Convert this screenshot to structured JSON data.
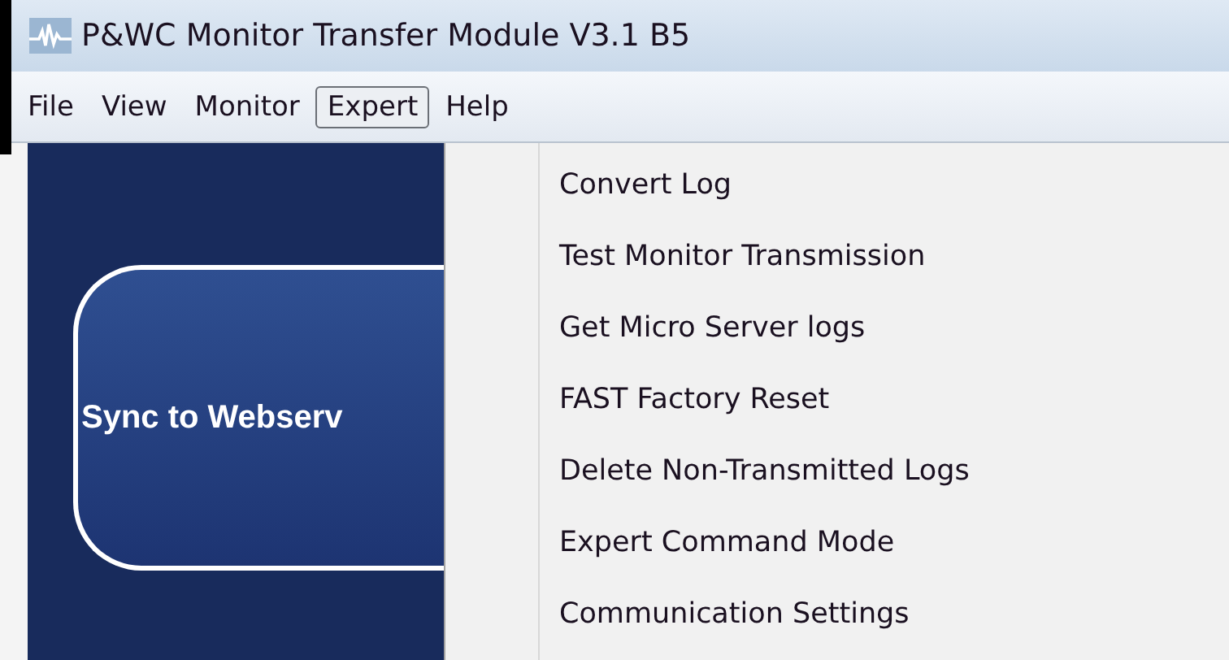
{
  "window": {
    "title": "P&WC Monitor Transfer Module V3.1 B5"
  },
  "menu_bar": [
    {
      "label": "File",
      "selected": false
    },
    {
      "label": "View",
      "selected": false
    },
    {
      "label": "Monitor",
      "selected": false
    },
    {
      "label": "Expert",
      "selected": true
    },
    {
      "label": "Help",
      "selected": false
    }
  ],
  "main_panel": {
    "sync_button": "Sync to Webserv"
  },
  "dropdown_menu": [
    {
      "label": "Convert Log"
    },
    {
      "label": "Test Monitor Transmission"
    },
    {
      "label": "Get Micro Server logs"
    },
    {
      "label": "FAST Factory Reset"
    },
    {
      "label": "Delete Non-Transmitted Logs"
    },
    {
      "label": "Expert Command Mode"
    },
    {
      "label": "Communication Settings"
    }
  ]
}
